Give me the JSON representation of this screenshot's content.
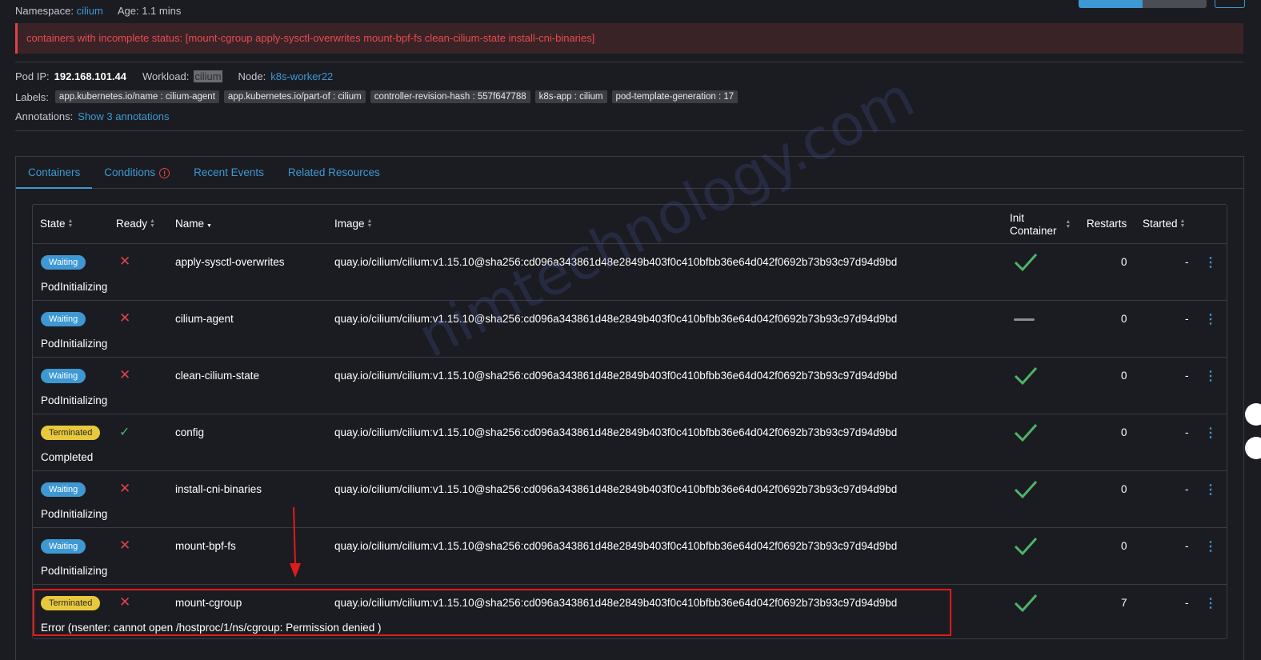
{
  "header": {
    "namespace_label": "Namespace:",
    "namespace_value": "cilium",
    "age_label": "Age:",
    "age_value": "1.1 mins"
  },
  "banner": {
    "text": "containers with incomplete status: [mount-cgroup apply-sysctl-overwrites mount-bpf-fs clean-cilium-state install-cni-binaries]"
  },
  "details": {
    "pod_ip_label": "Pod IP:",
    "pod_ip_value": "192.168.101.44",
    "workload_label": "Workload:",
    "workload_value": "cilium",
    "node_label": "Node:",
    "node_value": "k8s-worker22",
    "labels_label": "Labels:",
    "labels": [
      "app.kubernetes.io/name : cilium-agent",
      "app.kubernetes.io/part-of : cilium",
      "controller-revision-hash : 557f647788",
      "k8s-app : cilium",
      "pod-template-generation : 17"
    ],
    "annotations_label": "Annotations:",
    "annotations_link": "Show 3 annotations"
  },
  "tabs": [
    {
      "label": "Containers"
    },
    {
      "label": "Conditions"
    },
    {
      "label": "Recent Events"
    },
    {
      "label": "Related Resources"
    }
  ],
  "table": {
    "headers": {
      "state": "State",
      "ready": "Ready",
      "name": "Name",
      "image": "Image",
      "init_line1": "Init",
      "init_line2": "Container",
      "restarts": "Restarts",
      "started": "Started"
    },
    "rows": [
      {
        "state": "Waiting",
        "detail": "PodInitializing",
        "ready": false,
        "name": "apply-sysctl-overwrites",
        "image": "quay.io/cilium/cilium:v1.15.10@sha256:cd096a343861d48e2849b403f0c410bfbb36e64d042f0692b73b93c97d94d9bd",
        "init": true,
        "restarts": "0",
        "started": "-"
      },
      {
        "state": "Waiting",
        "detail": "PodInitializing",
        "ready": false,
        "name": "cilium-agent",
        "image": "quay.io/cilium/cilium:v1.15.10@sha256:cd096a343861d48e2849b403f0c410bfbb36e64d042f0692b73b93c97d94d9bd",
        "init": false,
        "restarts": "0",
        "started": "-"
      },
      {
        "state": "Waiting",
        "detail": "PodInitializing",
        "ready": false,
        "name": "clean-cilium-state",
        "image": "quay.io/cilium/cilium:v1.15.10@sha256:cd096a343861d48e2849b403f0c410bfbb36e64d042f0692b73b93c97d94d9bd",
        "init": true,
        "restarts": "0",
        "started": "-"
      },
      {
        "state": "Terminated",
        "detail": "Completed",
        "ready": true,
        "name": "config",
        "image": "quay.io/cilium/cilium:v1.15.10@sha256:cd096a343861d48e2849b403f0c410bfbb36e64d042f0692b73b93c97d94d9bd",
        "init": true,
        "restarts": "0",
        "started": "-"
      },
      {
        "state": "Waiting",
        "detail": "PodInitializing",
        "ready": false,
        "name": "install-cni-binaries",
        "image": "quay.io/cilium/cilium:v1.15.10@sha256:cd096a343861d48e2849b403f0c410bfbb36e64d042f0692b73b93c97d94d9bd",
        "init": true,
        "restarts": "0",
        "started": "-"
      },
      {
        "state": "Waiting",
        "detail": "PodInitializing",
        "ready": false,
        "name": "mount-bpf-fs",
        "image": "quay.io/cilium/cilium:v1.15.10@sha256:cd096a343861d48e2849b403f0c410bfbb36e64d042f0692b73b93c97d94d9bd",
        "init": true,
        "restarts": "0",
        "started": "-"
      },
      {
        "state": "Terminated",
        "detail": "Error (nsenter: cannot open /hostproc/1/ns/cgroup: Permission denied )",
        "ready": false,
        "name": "mount-cgroup",
        "image": "quay.io/cilium/cilium:v1.15.10@sha256:cd096a343861d48e2849b403f0c410bfbb36e64d042f0692b73b93c97d94d9bd",
        "init": true,
        "restarts": "7",
        "started": "-"
      }
    ]
  },
  "watermark": "nimtechnology.com",
  "colors": {
    "accent": "#3d98d3",
    "error": "#e0414a",
    "success": "#4fb36b",
    "warning": "#e8c93c",
    "background": "#1b1c21"
  }
}
